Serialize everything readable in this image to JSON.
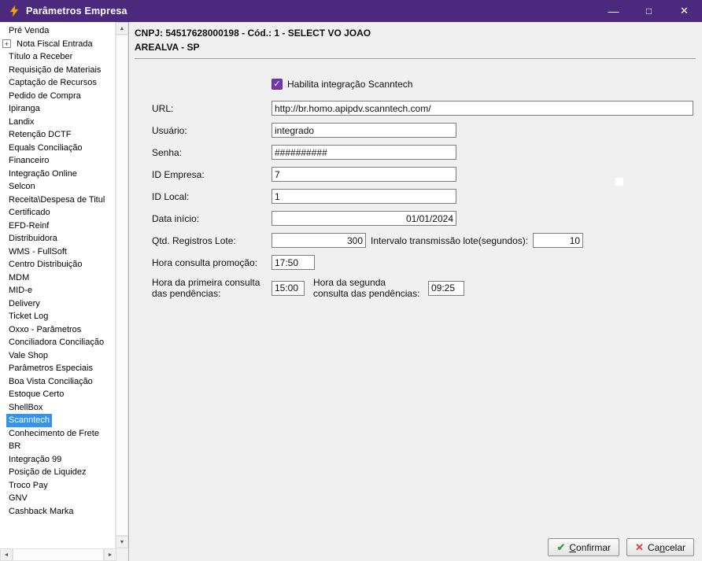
{
  "window": {
    "title": "Parâmetros Empresa",
    "controls": {
      "minimize": "—",
      "maximize": "□",
      "close": "✕"
    }
  },
  "sidebar": {
    "expand_glyph": "+",
    "scroll": {
      "up": "▲",
      "down": "▼",
      "left": "◄",
      "right": "►"
    },
    "items": [
      {
        "label": "Pré Venda"
      },
      {
        "label": "Nota Fiscal Entrada",
        "expandable": true
      },
      {
        "label": "Título a Receber"
      },
      {
        "label": "Requisição de Materiais"
      },
      {
        "label": "Captação de Recursos"
      },
      {
        "label": "Pedido de Compra"
      },
      {
        "label": "Ipiranga"
      },
      {
        "label": "Landix"
      },
      {
        "label": "Retenção DCTF"
      },
      {
        "label": "Equals Conciliação"
      },
      {
        "label": "Financeiro"
      },
      {
        "label": "Integração Online"
      },
      {
        "label": "Selcon"
      },
      {
        "label": "Receita\\Despesa de Titul"
      },
      {
        "label": "Certificado"
      },
      {
        "label": "EFD-Reinf"
      },
      {
        "label": "Distribuidora"
      },
      {
        "label": "WMS - FullSoft"
      },
      {
        "label": "Centro Distribuição"
      },
      {
        "label": "MDM"
      },
      {
        "label": "MID-e"
      },
      {
        "label": "Delivery"
      },
      {
        "label": "Ticket Log"
      },
      {
        "label": "Oxxo - Parâmetros"
      },
      {
        "label": "Conciliadora Conciliação"
      },
      {
        "label": "Vale Shop"
      },
      {
        "label": "Parâmetros Especiais"
      },
      {
        "label": "Boa Vista Conciliação"
      },
      {
        "label": "Estoque Certo"
      },
      {
        "label": "ShellBox"
      },
      {
        "label": "Scanntech",
        "selected": true
      },
      {
        "label": "Conhecimento de Frete"
      },
      {
        "label": "BR"
      },
      {
        "label": "Integração 99"
      },
      {
        "label": "Posição de Liquidez"
      },
      {
        "label": "Troco Pay"
      },
      {
        "label": "GNV"
      },
      {
        "label": "Cashback Marka"
      }
    ]
  },
  "header": {
    "line1": "CNPJ: 54517628000198 - Cód.: 1 - SELECT VO JOAO",
    "line2": "AREALVA - SP"
  },
  "form": {
    "integration_checkbox": {
      "label": "Habilita integração Scanntech",
      "checked": true,
      "check_glyph": "✓"
    },
    "url": {
      "label": "URL:",
      "value": "http://br.homo.apipdv.scanntech.com/"
    },
    "usuario": {
      "label": "Usuário:",
      "value": "integrado"
    },
    "senha": {
      "label": "Senha:",
      "value": "##########"
    },
    "id_empresa": {
      "label": "ID Empresa:",
      "value": "7"
    },
    "id_local": {
      "label": "ID Local:",
      "value": "1"
    },
    "data_inicio": {
      "label": "Data início:",
      "value": "01/01/2024"
    },
    "qtd_registros_lote": {
      "label": "Qtd. Registros Lote:",
      "value": "300"
    },
    "intervalo_transmissao": {
      "label": "Intervalo transmissão lote(segundos):",
      "value": "10"
    },
    "hora_consulta_promocao": {
      "label": "Hora consulta promoção:",
      "value": "17:50"
    },
    "hora_primeira_consulta": {
      "label": "Hora da primeira consulta das pendências:",
      "value": "15:00"
    },
    "hora_segunda_consulta": {
      "label": "Hora da segunda consulta das pendências:",
      "value": "09:25"
    }
  },
  "footer": {
    "confirm": {
      "pre": "",
      "accel": "C",
      "post": "onfirmar",
      "icon": "✔"
    },
    "cancel": {
      "pre": "Ca",
      "accel": "n",
      "post": "celar",
      "icon": "✕"
    }
  }
}
